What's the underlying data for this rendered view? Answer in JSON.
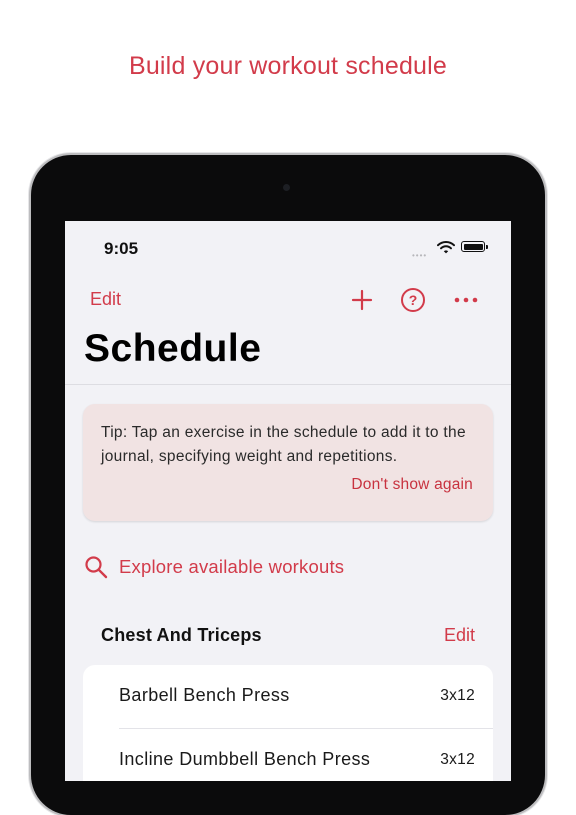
{
  "headline": "Build your workout schedule",
  "status_bar": {
    "time": "9:05",
    "signal": "••••"
  },
  "nav": {
    "edit_label": "Edit",
    "help_glyph": "?",
    "icons": [
      "plus-icon",
      "help-icon",
      "more-icon"
    ]
  },
  "page_title": "Schedule",
  "tip": {
    "text": "Tip: Tap an exercise in the schedule to add it to the journal, specifying weight and repetitions.",
    "dismiss_label": "Don't show again"
  },
  "explore": {
    "label": "Explore available workouts"
  },
  "section": {
    "title": "Chest And Triceps",
    "edit_label": "Edit",
    "exercises": [
      {
        "name": "Barbell Bench Press",
        "sets": "3x12"
      },
      {
        "name": "Incline Dumbbell Bench Press",
        "sets": "3x12"
      }
    ]
  },
  "colors": {
    "accent": "#d23b4a",
    "screen_bg": "#f2f2f6",
    "tip_bg": "#f1e3e3",
    "card_bg": "#ffffff",
    "device_bezel": "#0b0b0c"
  }
}
